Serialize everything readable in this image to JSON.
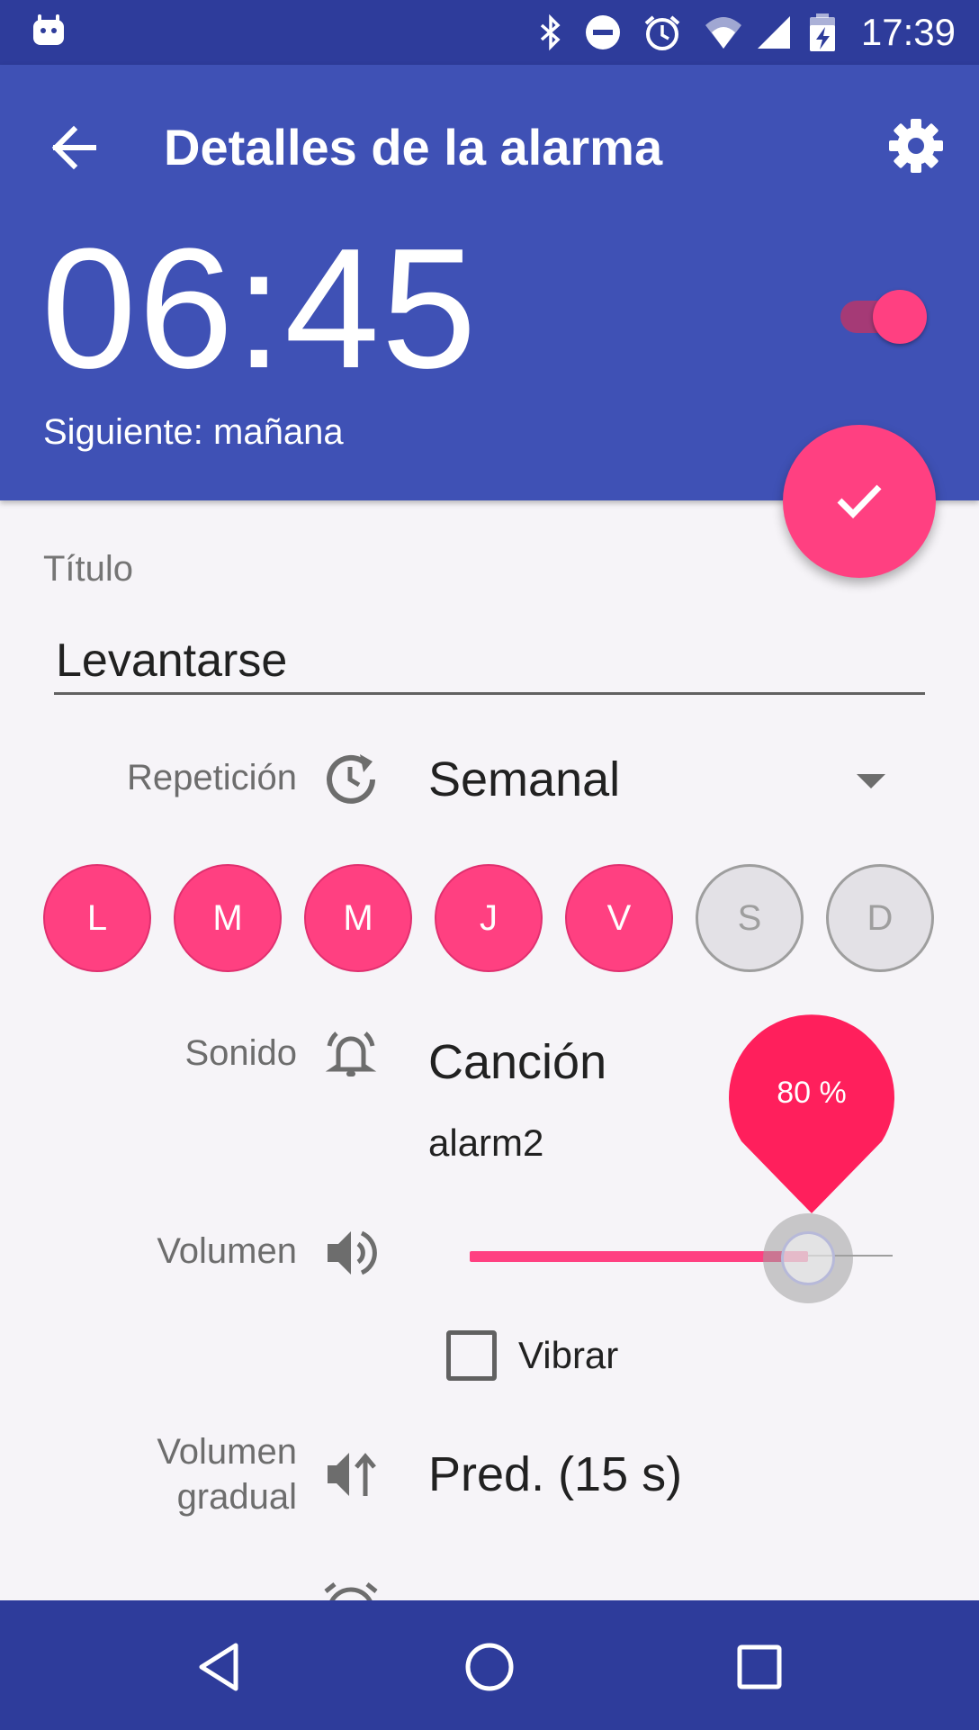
{
  "status_bar": {
    "time": "17:39",
    "icons": [
      "android-notification-icon",
      "bluetooth-icon",
      "do-not-disturb-icon",
      "alarm-icon",
      "wifi-icon",
      "cell-signal-icon",
      "battery-charging-icon"
    ]
  },
  "app_bar": {
    "title": "Detalles de la alarma",
    "back_icon": "arrow-back-icon",
    "settings_icon": "gear-icon"
  },
  "alarm": {
    "time": "06:45",
    "next": "Siguiente: mañana",
    "enabled": true
  },
  "fab": {
    "icon": "check-icon"
  },
  "title_field": {
    "label": "Título",
    "value": "Levantarse"
  },
  "repeat": {
    "label": "Repetición",
    "value": "Semanal",
    "icon": "repeat-clock-icon"
  },
  "days": [
    {
      "label": "L",
      "selected": true
    },
    {
      "label": "M",
      "selected": true
    },
    {
      "label": "M",
      "selected": true
    },
    {
      "label": "J",
      "selected": true
    },
    {
      "label": "V",
      "selected": true
    },
    {
      "label": "S",
      "selected": false
    },
    {
      "label": "D",
      "selected": false
    }
  ],
  "sound": {
    "label": "Sonido",
    "value": "Canción",
    "file": "alarm2",
    "icon": "alarm-bell-icon"
  },
  "volume": {
    "label": "Volumen",
    "percent_label": "80 %",
    "level": 0.8,
    "icon": "volume-up-icon"
  },
  "vibrate": {
    "label": "Vibrar",
    "checked": false
  },
  "gradual": {
    "label_line1": "Volumen",
    "label_line2": "gradual",
    "value": "Pred. (15 s)",
    "icon": "volume-gradual-icon"
  },
  "colors": {
    "primary": "#3f51b5",
    "primary_dark": "#2e3c9b",
    "accent": "#ff4081"
  }
}
